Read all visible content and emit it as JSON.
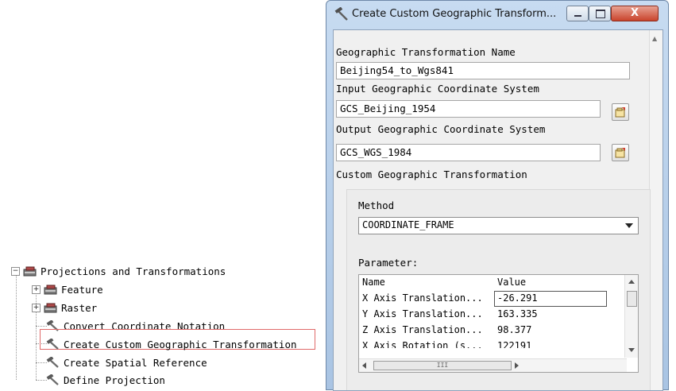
{
  "tree": {
    "root": {
      "label": "Projections and Transformations",
      "expander": "−",
      "icon": "toolbox-icon"
    },
    "children": [
      {
        "label": "Feature",
        "expander": "+",
        "icon": "toolbox-icon"
      },
      {
        "label": "Raster",
        "expander": "+",
        "icon": "toolbox-icon"
      },
      {
        "label": "Convert Coordinate Notation",
        "icon": "hammer-tool-icon"
      },
      {
        "label": "Create Custom Geographic Transformation",
        "icon": "hammer-tool-icon",
        "selected": true
      },
      {
        "label": "Create Spatial Reference",
        "icon": "hammer-tool-icon"
      },
      {
        "label": "Define Projection",
        "icon": "hammer-tool-icon"
      }
    ]
  },
  "dialog": {
    "title": "Create Custom Geographic Transform...",
    "close_label": "X",
    "name_label": "Geographic Transformation Name",
    "name_value": "Beijing54_to_Wgs841",
    "input_label": "Input Geographic Coordinate System",
    "input_value": "GCS_Beijing_1954",
    "output_label": "Output Geographic Coordinate System",
    "output_value": "GCS_WGS_1984",
    "custom_label": "Custom Geographic Transformation",
    "method_label": "Method",
    "method_value": "COORDINATE_FRAME",
    "parameter_label": "Parameter:",
    "grid": {
      "headers": [
        "Name",
        "Value"
      ],
      "rows": [
        {
          "name": "X Axis Translation...",
          "value": "-26.291"
        },
        {
          "name": "Y Axis Translation...",
          "value": "163.335"
        },
        {
          "name": "Z Axis Translation...",
          "value": "98.377"
        },
        {
          "name": "X Axis Rotation (s...",
          "value": "122191"
        }
      ],
      "hscroll_thumb": "III"
    }
  },
  "colors": {
    "selection_border": "#e06a6a",
    "close_button": "#c9442c"
  }
}
